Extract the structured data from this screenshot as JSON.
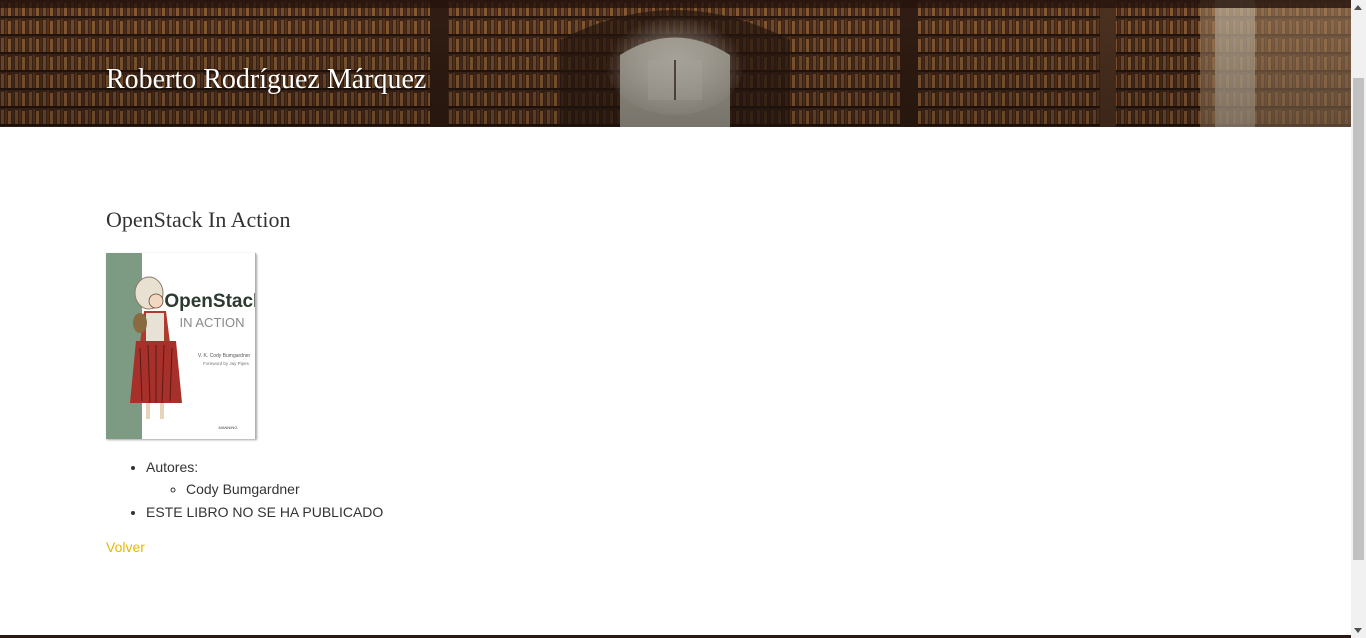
{
  "header": {
    "site_title": "Roberto Rodríguez Márquez"
  },
  "book": {
    "title": "OpenStack In Action",
    "cover": {
      "title_line1": "OpenStack",
      "title_line2": "IN ACTION",
      "author": "V. K. Cody Bumgardner",
      "foreword": "Foreword by Jay Pipes",
      "publisher": "MANNING"
    },
    "authors_label": "Autores:",
    "authors": [
      "Cody Bumgardner"
    ],
    "status": "ESTE LIBRO NO SE HA PUBLICADO"
  },
  "nav": {
    "back_label": "Volver"
  },
  "colors": {
    "link": "#e6b800",
    "text": "#333333",
    "cover_spine": "#7d9a83"
  }
}
